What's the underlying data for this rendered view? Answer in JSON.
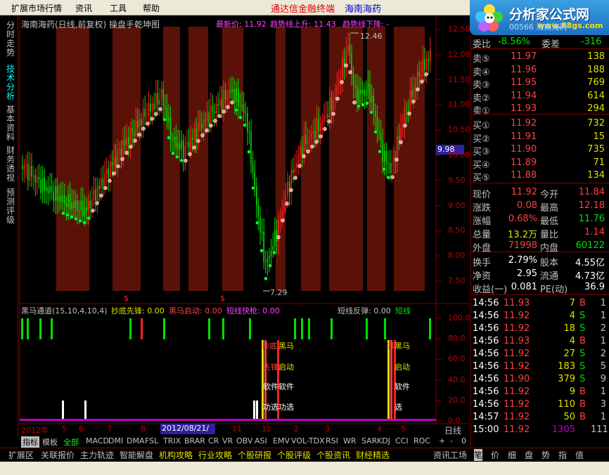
{
  "menubar": {
    "items": [
      "扩展市场行情",
      "资讯",
      "工具",
      "帮助"
    ],
    "app_title": "通达信金融终端",
    "stock_name": "海南海药"
  },
  "logo": {
    "main": "分析家公式网",
    "url": "www.88gs.com",
    "corner_text": "00566 海南海药"
  },
  "left_tabs": [
    "分时走势",
    "技术分析",
    "基本资料",
    "财务透视",
    "预测评级"
  ],
  "left_tabs_active": 1,
  "chart": {
    "title": "海南海药(日线,前复权) 操盘手乾坤图",
    "legend_latest": "最新价: 11.92",
    "legend_up": "趋势线上升: 11.43",
    "legend_down": "趋势线下降: -",
    "high_label": "12.46",
    "low_label": "7.29",
    "price_tag": "9.98",
    "y_labels": [
      "12.50",
      "12.00",
      "11.50",
      "11.00",
      "10.50",
      "10.00",
      "9.50",
      "9.00",
      "8.50",
      "8.00",
      "7.50"
    ],
    "x_labels": [
      "2012年",
      "5",
      "6",
      "7",
      "8",
      "9",
      "10",
      "11",
      "12",
      "2",
      "3",
      "4",
      "5"
    ],
    "date_box": "2012/08/21/二",
    "period": "日线"
  },
  "indicator": {
    "name": "黑马通道(15,10,4,10,4)",
    "s1": "抄底先锋: 0.00",
    "s2": "黑马启动: 0.00",
    "s3": "短线快枪: 0.00",
    "s4": "短线反弹: 0.00",
    "s5": "短线",
    "y_labels": [
      "100.0",
      "80.0",
      "60.0",
      "40.0",
      "20.0",
      "0.0"
    ],
    "ann_text": [
      "抄底",
      "黑马",
      "先锋",
      "启动",
      "软件",
      "软件",
      "功选",
      "功选",
      "抄",
      "黑马",
      "启动",
      "软件",
      "选"
    ]
  },
  "tabbar": {
    "items": [
      "指标",
      "模板",
      "全部",
      "MACD",
      "DMI",
      "DMA",
      "FSL",
      "TRIX",
      "BRAR",
      "CR",
      "VR",
      "OBV",
      "ASI",
      "EMV",
      "VOL-TDX",
      "RSI",
      "WR",
      "SAR",
      "KDJ",
      "CCI",
      "ROC",
      "+",
      "-",
      "0"
    ]
  },
  "bottombar": {
    "items": [
      "扩展区",
      "关联报价",
      "主力轨迹",
      "智能解盘",
      "机构攻略",
      "行业攻略",
      "个股研报",
      "个股评级",
      "个股资讯",
      "财经精选",
      "资讯工场"
    ]
  },
  "quote": {
    "weibi_label": "委比",
    "weibi": "-8.56%",
    "weicha_label": "委差",
    "weicha": "-316",
    "asks": [
      {
        "label": "卖⑤",
        "price": "11.97",
        "vol": "138"
      },
      {
        "label": "卖④",
        "price": "11.96",
        "vol": "188"
      },
      {
        "label": "卖③",
        "price": "11.95",
        "vol": "769"
      },
      {
        "label": "卖②",
        "price": "11.94",
        "vol": "614"
      },
      {
        "label": "卖①",
        "price": "11.93",
        "vol": "294"
      }
    ],
    "bids": [
      {
        "label": "买①",
        "price": "11.92",
        "vol": "732"
      },
      {
        "label": "买②",
        "price": "11.91",
        "vol": "15"
      },
      {
        "label": "买③",
        "price": "11.90",
        "vol": "735"
      },
      {
        "label": "买④",
        "price": "11.89",
        "vol": "71"
      },
      {
        "label": "买⑤",
        "price": "11.88",
        "vol": "134"
      }
    ],
    "stats1": [
      {
        "l1": "现价",
        "v1": "11.92",
        "l2": "今开",
        "v2": "11.84"
      },
      {
        "l1": "涨跌",
        "v1": "0.08",
        "l2": "最高",
        "v2": "12.18"
      },
      {
        "l1": "涨幅",
        "v1": "0.68%",
        "l2": "最低",
        "v2": "11.76"
      },
      {
        "l1": "总量",
        "v1": "13.2万",
        "l2": "量比",
        "v2": "1.14"
      },
      {
        "l1": "外盘",
        "v1": "71998",
        "l2": "内盘",
        "v2": "60122"
      }
    ],
    "stats2": [
      {
        "l1": "换手",
        "v1": "2.79%",
        "l2": "股本",
        "v2": "4.55亿"
      },
      {
        "l1": "净资",
        "v1": "2.95",
        "l2": "流通",
        "v2": "4.73亿"
      },
      {
        "l1": "收益(一)",
        "v1": "0.081",
        "l2": "PE(动)",
        "v2": "36.9"
      }
    ],
    "ticks": [
      {
        "time": "14:56",
        "price": "11.93",
        "vol": "7",
        "bs": "B",
        "n": "1"
      },
      {
        "time": "14:56",
        "price": "11.92",
        "vol": "4",
        "bs": "S",
        "n": "1"
      },
      {
        "time": "14:56",
        "price": "11.92",
        "vol": "18",
        "bs": "S",
        "n": "2"
      },
      {
        "time": "14:56",
        "price": "11.93",
        "vol": "4",
        "bs": "B",
        "n": "1"
      },
      {
        "time": "14:56",
        "price": "11.92",
        "vol": "27",
        "bs": "S",
        "n": "2"
      },
      {
        "time": "14:56",
        "price": "11.92",
        "vol": "183",
        "bs": "S",
        "n": "5"
      },
      {
        "time": "14:56",
        "price": "11.90",
        "vol": "379",
        "bs": "S",
        "n": "9"
      },
      {
        "time": "14:56",
        "price": "11.92",
        "vol": "9",
        "bs": "B",
        "n": "1"
      },
      {
        "time": "14:56",
        "price": "11.92",
        "vol": "110",
        "bs": "B",
        "n": "3"
      },
      {
        "time": "14:57",
        "price": "11.92",
        "vol": "50",
        "bs": "B",
        "n": "1"
      },
      {
        "time": "15:00",
        "price": "11.92",
        "vol": "1305",
        "bs": "",
        "n": "111"
      }
    ],
    "tabs": [
      "笔",
      "价",
      "细",
      "盘",
      "势",
      "指",
      "值"
    ]
  },
  "colors": {
    "up": "#ff4040",
    "down": "#00e000",
    "band": "#5a1208",
    "grid": "#800000"
  }
}
